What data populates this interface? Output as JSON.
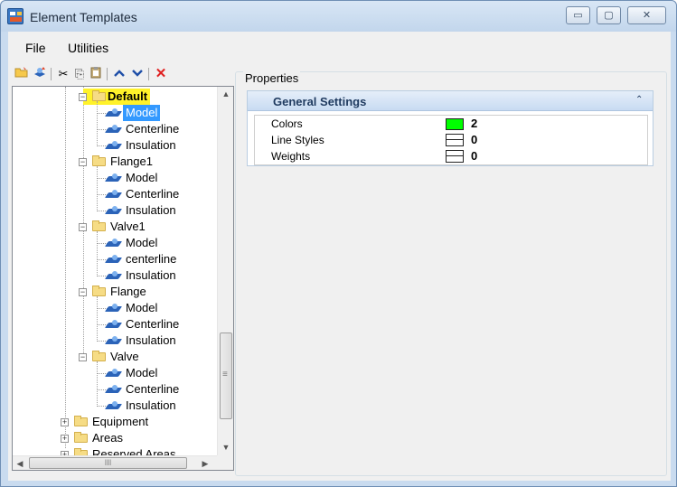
{
  "window": {
    "title": "Element Templates",
    "controls": {
      "minimize": "▭",
      "maximize": "▢",
      "close": "✕"
    }
  },
  "menu": {
    "file": "File",
    "utilities": "Utilities"
  },
  "toolbar": {
    "icons": [
      "open-folder-icon",
      "import-icon",
      "cut-icon",
      "copy-icon",
      "paste-icon",
      "move-up-icon",
      "move-down-icon",
      "delete-icon"
    ],
    "glyphs": {
      "cut": "✂",
      "copy": "⎘",
      "paste": "📋",
      "up": "⌃",
      "down": "⌄",
      "delete": "✕"
    }
  },
  "tree": {
    "groups": [
      {
        "label": "Default",
        "children": [
          "Model",
          "Centerline",
          "Insulation"
        ]
      },
      {
        "label": "Flange1",
        "children": [
          "Model",
          "Centerline",
          "Insulation"
        ]
      },
      {
        "label": "Valve1",
        "children": [
          "Model",
          "centerline",
          "Insulation"
        ]
      },
      {
        "label": "Flange",
        "children": [
          "Model",
          "Centerline",
          "Insulation"
        ]
      },
      {
        "label": "Valve",
        "children": [
          "Model",
          "Centerline",
          "Insulation"
        ]
      }
    ],
    "top_level": [
      "Equipment",
      "Areas",
      "Reserved Areas"
    ],
    "selected_item": "Model",
    "expander_minus": "−",
    "expander_plus": "+"
  },
  "scrollbars": {
    "up": "▲",
    "down": "▼",
    "left": "◀",
    "right": "▶",
    "grip_v": "≡",
    "grip_h": "III"
  },
  "properties": {
    "title": "Properties",
    "section_title": "General Settings",
    "collapse_glyph": "⌃",
    "rows": [
      {
        "name": "Colors",
        "value": "2",
        "swatch": "#00ff00"
      },
      {
        "name": "Line Styles",
        "value": "0"
      },
      {
        "name": "Weights",
        "value": "0"
      }
    ]
  },
  "colors": {
    "selection": "#3399ff",
    "highlight": "#fff22a",
    "color_swatch": "#00ff00",
    "delete_icon": "#e02020",
    "arrow_icon": "#1f4fa8"
  }
}
